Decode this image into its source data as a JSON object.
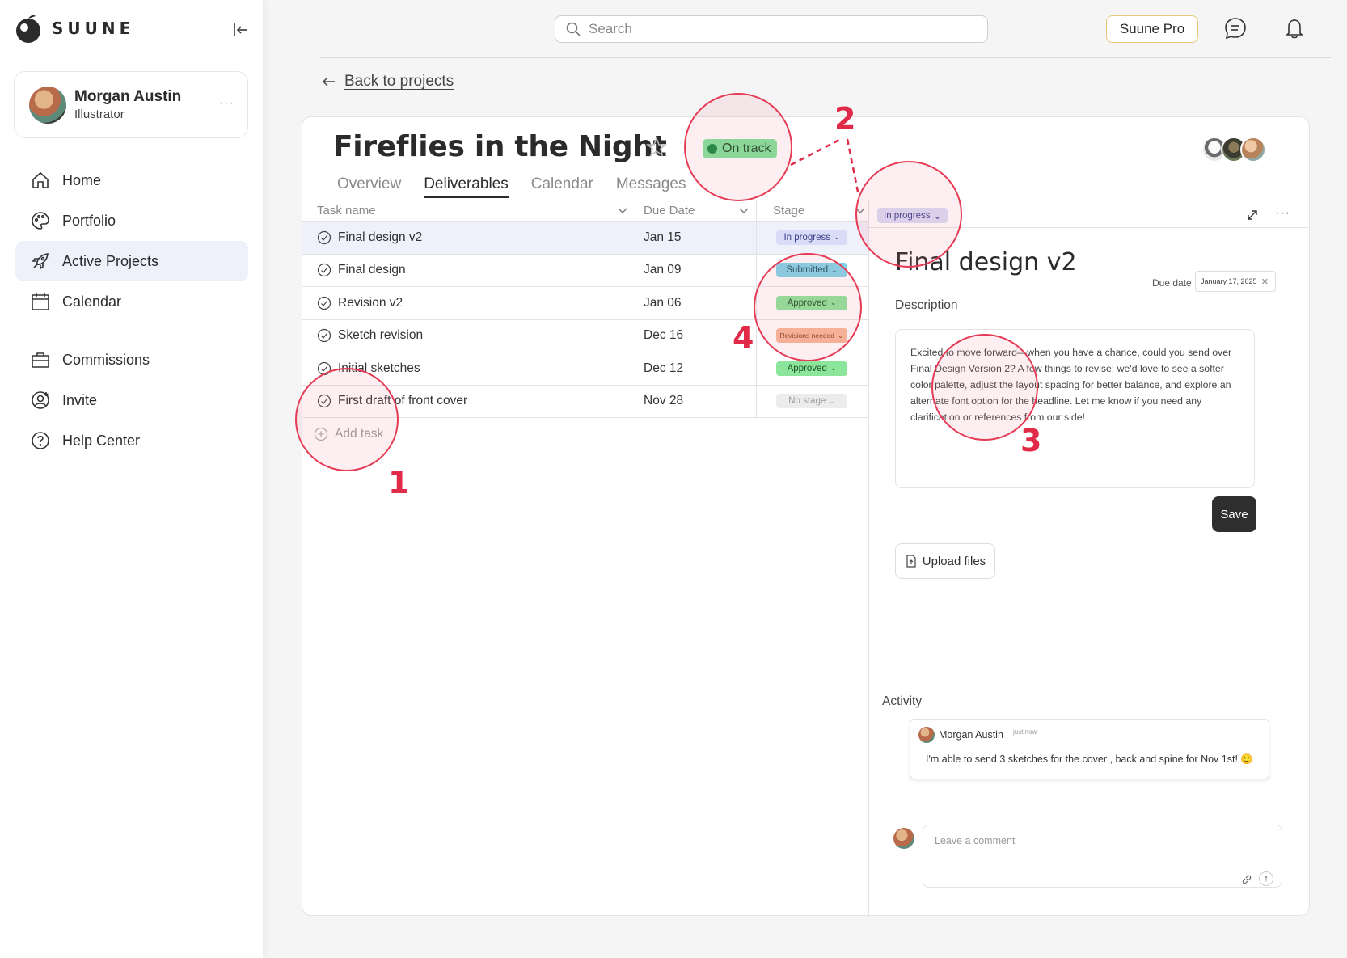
{
  "brand": {
    "name": "SUUNE"
  },
  "profile": {
    "name": "Morgan Austin",
    "role": "Illustrator",
    "more": "···"
  },
  "nav": {
    "home": "Home",
    "portfolio": "Portfolio",
    "active_projects": "Active Projects",
    "calendar": "Calendar",
    "commissions": "Commissions",
    "invite": "Invite",
    "help": "Help Center"
  },
  "topbar": {
    "search_placeholder": "Search",
    "pro_label": "Suune Pro"
  },
  "back_link": "Back to projects",
  "project": {
    "title": "Fireflies in the Night",
    "status": "On track",
    "tabs": [
      "Overview",
      "Deliverables",
      "Calendar",
      "Messages"
    ],
    "active_tab": "Deliverables"
  },
  "table": {
    "headers": {
      "task": "Task name",
      "due": "Due Date",
      "stage": "Stage"
    },
    "rows": [
      {
        "task": "Final design v2",
        "due": "Jan 15",
        "stage": "In progress",
        "stage_bg": "#d9dcf7",
        "stage_fg": "#3b3f8c"
      },
      {
        "task": "Final design",
        "due": "Jan 09",
        "stage": "Submitted",
        "stage_bg": "#7fd4ea",
        "stage_fg": "#1b4e5e"
      },
      {
        "task": "Revision v2",
        "due": "Jan 06",
        "stage": "Approved",
        "stage_bg": "#8be59a",
        "stage_fg": "#1e5228"
      },
      {
        "task": "Sketch revision",
        "due": "Dec 16",
        "stage": "Revisions needed",
        "stage_bg": "#f5b99a",
        "stage_fg": "#8a3a1c"
      },
      {
        "task": "Initial sketches",
        "due": "Dec 12",
        "stage": "Approved",
        "stage_bg": "#8be59a",
        "stage_fg": "#1e5228"
      },
      {
        "task": "First draft of front cover",
        "due": "Nov 28",
        "stage": "No stage",
        "stage_bg": "#ececec",
        "stage_fg": "#9a9a9a"
      }
    ],
    "add_task": "Add task"
  },
  "detail": {
    "stage": "In progress",
    "title": "Final design v2",
    "due_label": "Due date",
    "due_value": "January 17, 2025",
    "description_label": "Description",
    "description": "Excited to move forward—when you have a chance, could you send over Final Design Version 2? A few things to revise: we'd love to see a softer color palette, adjust the layout spacing for better balance, and explore an alternate font option for the headline. Let me know if you need any clarification or references from our side!",
    "save": "Save",
    "upload": "Upload files",
    "more": "···"
  },
  "activity": {
    "label": "Activity",
    "comment": {
      "author": "Morgan Austin",
      "time": "just now",
      "text": "I'm able to send 3 sketches for the cover , back and spine for Nov 1st! 🙂"
    },
    "placeholder": "Leave a comment"
  },
  "annotations": [
    "1",
    "2",
    "3",
    "4"
  ],
  "colors": {
    "accent_annotation": "#e02a47",
    "on_track": "#7ee39a",
    "active_nav": "#eef0fa"
  }
}
